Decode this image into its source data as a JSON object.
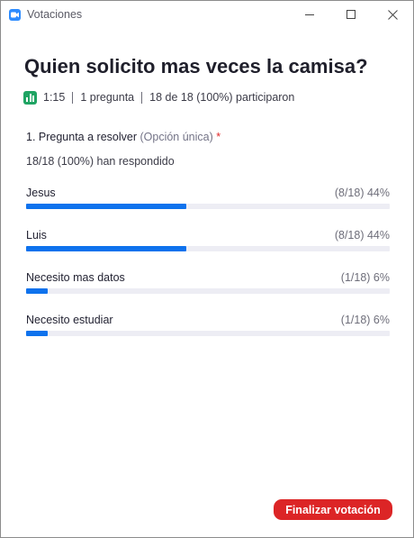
{
  "window": {
    "title": "Votaciones",
    "icon": "zoom-camera-icon",
    "controls": [
      "minimize-icon",
      "maximize-icon",
      "close-icon"
    ]
  },
  "poll": {
    "title": "Quien solicito mas veces la camisa?",
    "meta": {
      "time": "1:15",
      "questions": "1 pregunta",
      "participation": "18 de 18 (100%) participaron"
    },
    "question": {
      "label": "1. Pregunta a resolver",
      "type": "(Opción única)",
      "required_mark": "*",
      "responses": "18/18 (100%) han respondido"
    },
    "options": [
      {
        "label": "Jesus",
        "stat": "(8/18) 44%",
        "percent": 44
      },
      {
        "label": "Luis",
        "stat": "(8/18) 44%",
        "percent": 44
      },
      {
        "label": "Necesito mas datos",
        "stat": "(1/18) 6%",
        "percent": 6
      },
      {
        "label": "Necesito estudiar",
        "stat": "(1/18) 6%",
        "percent": 6
      }
    ]
  },
  "actions": {
    "end_label": "Finalizar votación"
  },
  "colors": {
    "accent": "#0e72ed",
    "track": "#ededf4",
    "end_button": "#dc2526",
    "poll_icon": "#1fa463",
    "required": "#e02828"
  }
}
